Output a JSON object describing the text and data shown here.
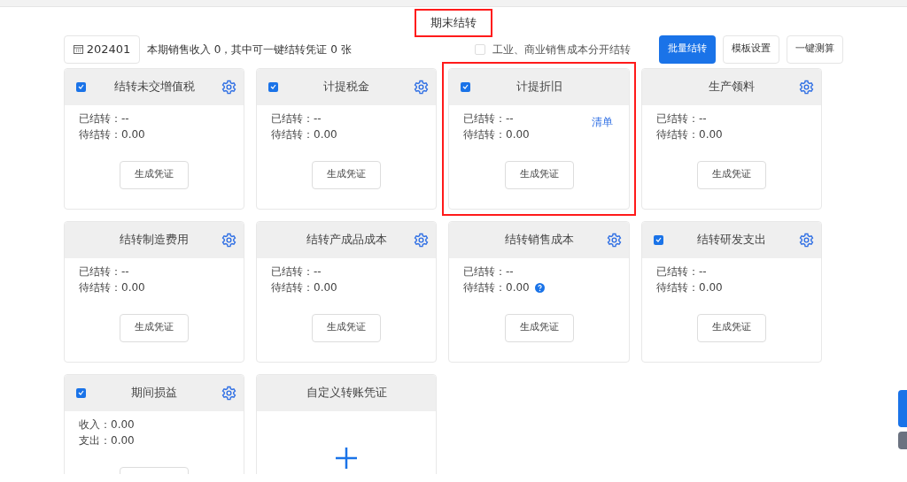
{
  "page_title": {
    "text": "期末结转",
    "highlighted": true
  },
  "toolbar": {
    "period": "202401",
    "summary": "本期销售收入 0，其中可一键结转凭证 0 张",
    "split_option": {
      "label": "工业、商业销售成本分开结转",
      "checked": false
    },
    "buttons": [
      {
        "label": "批量结转",
        "primary": true
      },
      {
        "label": "模板设置",
        "primary": false
      },
      {
        "label": "一键测算",
        "primary": false
      }
    ]
  },
  "cards": [
    {
      "kind": "transfer",
      "title": "结转未交增值税",
      "checkbox": true,
      "checked": true,
      "settings": true,
      "highlighted": false,
      "lines": [
        {
          "text": "已结转：--",
          "help": false
        },
        {
          "text": "待结转：0.00",
          "help": false
        }
      ],
      "button": "生成凭证"
    },
    {
      "kind": "transfer",
      "title": "计提税金",
      "checkbox": true,
      "checked": true,
      "settings": true,
      "highlighted": false,
      "lines": [
        {
          "text": "已结转：--",
          "help": false
        },
        {
          "text": "待结转：0.00",
          "help": false
        }
      ],
      "button": "生成凭证"
    },
    {
      "kind": "transfer",
      "title": "计提折旧",
      "checkbox": true,
      "checked": true,
      "settings": false,
      "highlighted": true,
      "link": "清单",
      "lines": [
        {
          "text": "已结转：--",
          "help": false
        },
        {
          "text": "待结转：0.00",
          "help": false
        }
      ],
      "button": "生成凭证"
    },
    {
      "kind": "transfer",
      "title": "生产领料",
      "checkbox": false,
      "settings": true,
      "highlighted": false,
      "lines": [
        {
          "text": "已结转：--",
          "help": false
        },
        {
          "text": "待结转：0.00",
          "help": false
        }
      ],
      "button": "生成凭证"
    },
    {
      "kind": "transfer",
      "title": "结转制造费用",
      "checkbox": false,
      "settings": true,
      "highlighted": false,
      "lines": [
        {
          "text": "已结转：--",
          "help": false
        },
        {
          "text": "待结转：0.00",
          "help": false
        }
      ],
      "button": "生成凭证"
    },
    {
      "kind": "transfer",
      "title": "结转产成品成本",
      "checkbox": false,
      "settings": true,
      "highlighted": false,
      "lines": [
        {
          "text": "已结转：--",
          "help": false
        },
        {
          "text": "待结转：0.00",
          "help": false
        }
      ],
      "button": "生成凭证"
    },
    {
      "kind": "transfer",
      "title": "结转销售成本",
      "checkbox": false,
      "settings": true,
      "highlighted": false,
      "lines": [
        {
          "text": "已结转：--",
          "help": false
        },
        {
          "text": "待结转：0.00",
          "help": true
        }
      ],
      "button": "生成凭证"
    },
    {
      "kind": "transfer",
      "title": "结转研发支出",
      "checkbox": true,
      "checked": true,
      "settings": true,
      "highlighted": false,
      "lines": [
        {
          "text": "已结转：--",
          "help": false
        },
        {
          "text": "待结转：0.00",
          "help": false
        }
      ],
      "button": "生成凭证"
    },
    {
      "kind": "transfer",
      "title": "期间损益",
      "checkbox": true,
      "checked": true,
      "settings": true,
      "highlighted": false,
      "lines": [
        {
          "text": "收入：0.00",
          "help": false
        },
        {
          "text": "支出：0.00",
          "help": false
        }
      ]
    },
    {
      "kind": "custom",
      "title": "自定义转账凭证"
    }
  ]
}
